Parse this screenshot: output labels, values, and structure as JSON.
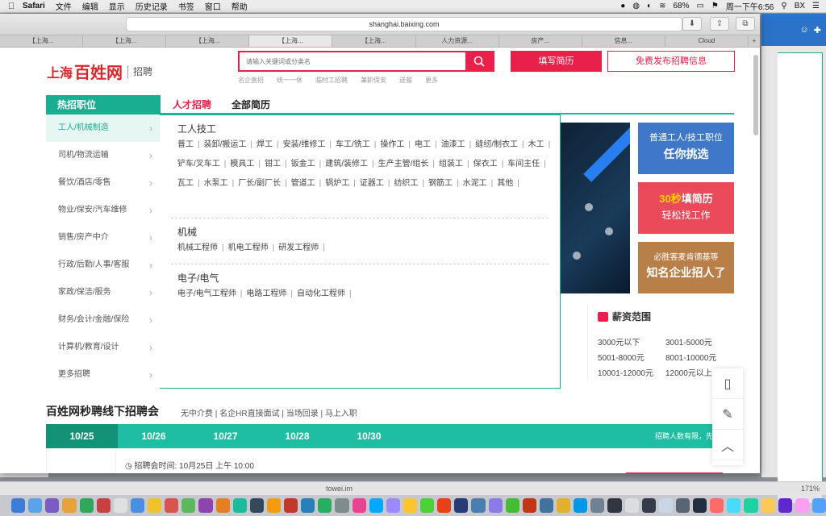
{
  "menubar": {
    "app": "Safari",
    "items": [
      "文件",
      "编辑",
      "显示",
      "历史记录",
      "书签",
      "窗口",
      "帮助"
    ],
    "battery": "68%",
    "clock": "周一下午6:56",
    "user": "BX"
  },
  "browser": {
    "url": "shanghai.baixing.com",
    "tabs": [
      "【上海...",
      "【上海...",
      "【上海...",
      "【上海...",
      "【上海...",
      "人力资源...",
      "房产...",
      "信息...",
      "Cloud"
    ],
    "status_url": "towei.im",
    "zoom": "171%"
  },
  "header": {
    "logo_city": "上海",
    "logo_brand": "百姓网",
    "logo_sub": "招聘",
    "search_placeholder": "请输入关键词或分类名",
    "btn_resume": "填写简历",
    "btn_post": "免费发布招聘信息",
    "hotwords": [
      "名企直招",
      "统一一休",
      "临时工招聘",
      "兼职保安",
      "送餐",
      "更多"
    ]
  },
  "nav": {
    "hot": "热招职位",
    "talent": "人才招聘",
    "all_resume": "全部简历"
  },
  "categories": [
    "工人/机械制造",
    "司机/物流运输",
    "餐饮/酒店/零售",
    "物业/保安/汽车维修",
    "销售/房产中介",
    "行政/后勤/人事/客服",
    "家政/保洁/服务",
    "财务/会计/金融/保险",
    "计算机/教育/设计",
    "更多招聘"
  ],
  "panel": {
    "group1_title": "工人技工",
    "group1_items": [
      "普工",
      "装卸/搬运工",
      "焊工",
      "安装/维修工",
      "车工/铣工",
      "操作工",
      "电工",
      "油漆工",
      "缝纫/制衣工",
      "木工",
      "铲车/叉车工",
      "模具工",
      "钳工",
      "钣金工",
      "建筑/装修工",
      "生产主管/组长",
      "组装工",
      "保衣工",
      "车间主任",
      "瓦工",
      "水泵工",
      "厂长/副厂长",
      "管道工",
      "锅炉工",
      "证器工",
      "纺织工",
      "钢筋工",
      "水泥工",
      "其他"
    ],
    "group2_title": "机械",
    "group2_items": [
      "机械工程师",
      "机电工程师",
      "研发工程师"
    ],
    "group3_title": "电子/电气",
    "group3_items": [
      "电子/电气工程师",
      "电路工程师",
      "自动化工程师"
    ]
  },
  "ads": {
    "ad1_l1": "普通工人/技工职位",
    "ad1_l2": "任你挑选",
    "ad2_highlight": "30秒",
    "ad2_l1": "填简历",
    "ad2_l2": "轻松找工作",
    "ad3_l1": "必胜客麦肯德基等",
    "ad3_l2": "知名企业招人了"
  },
  "salary": {
    "title": "薪资范围",
    "ranges": [
      "3000元以下",
      "3001-5000元",
      "5001-8000元",
      "8001-10000元",
      "10001-12000元",
      "12000元以上"
    ]
  },
  "fair": {
    "title": "百姓网秒聘线下招聘会",
    "tags": "无中介费 | 名企HR直接面试 | 当场回录 | 马上入职",
    "dates": [
      "10/25",
      "10/26",
      "10/27",
      "10/28",
      "10/30"
    ],
    "note": "招聘人数有限，先到先",
    "time": "招聘会时间: 10月25日 上午 10:00"
  },
  "colors": {
    "accent_green": "#1fbda1",
    "accent_red": "#e8204a"
  }
}
